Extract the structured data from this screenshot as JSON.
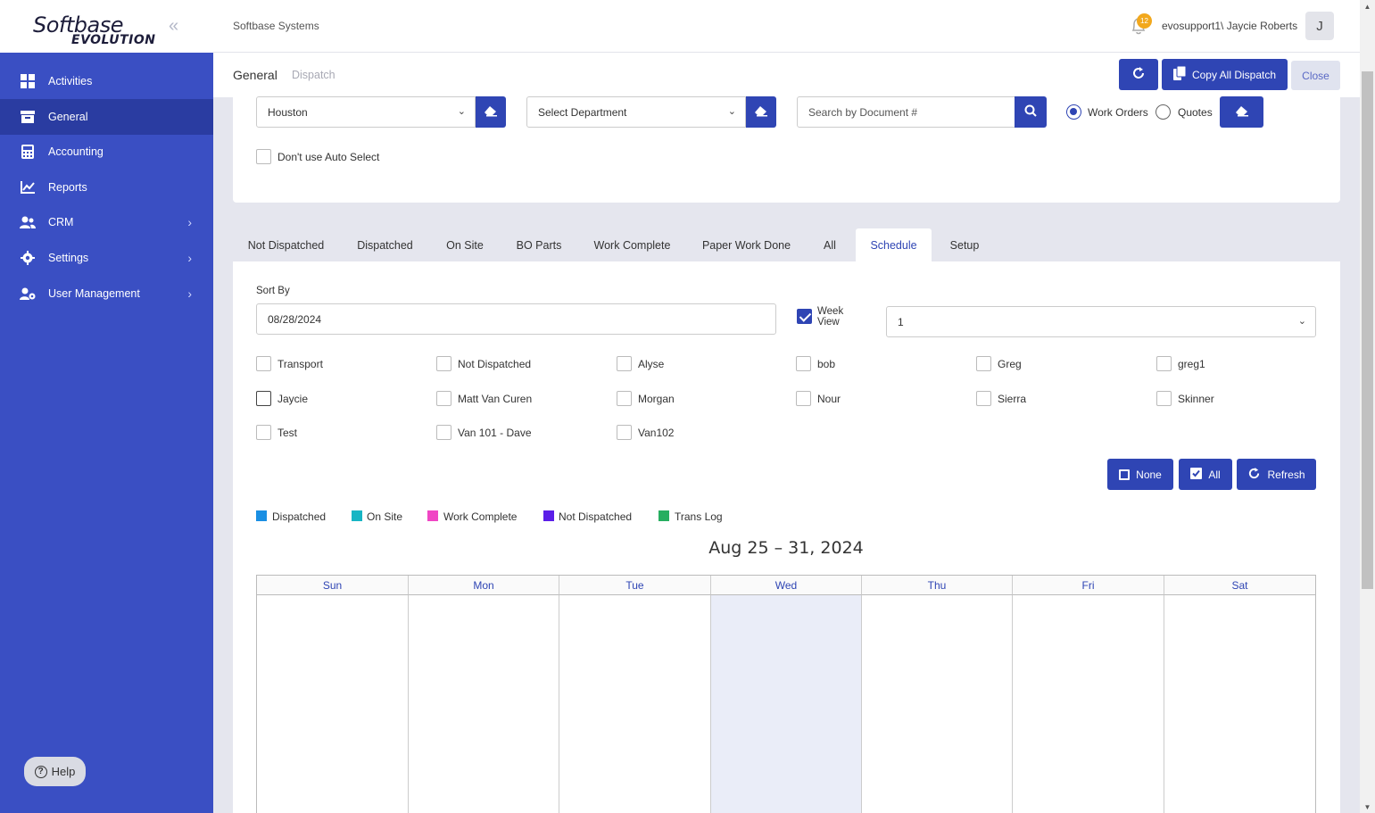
{
  "brand": {
    "logo_main": "Softbase",
    "logo_sub": "EVOLUTION"
  },
  "sidebar": {
    "items": [
      {
        "label": "Activities",
        "icon": "grid-icon"
      },
      {
        "label": "General",
        "icon": "archive-icon",
        "active": true
      },
      {
        "label": "Accounting",
        "icon": "calculator-icon"
      },
      {
        "label": "Reports",
        "icon": "chart-icon"
      },
      {
        "label": "CRM",
        "icon": "users-icon",
        "expandable": true
      },
      {
        "label": "Settings",
        "icon": "gear-icon",
        "expandable": true
      },
      {
        "label": "User Management",
        "icon": "user-gear-icon",
        "expandable": true
      }
    ],
    "help_label": "Help"
  },
  "topbar": {
    "company": "Softbase Systems",
    "notification_count": "12",
    "username": "evosupport1\\ Jaycie Roberts",
    "avatar_initial": "J"
  },
  "subheader": {
    "title": "General",
    "subtitle": "Dispatch",
    "copy_all_label": "Copy All Dispatch",
    "close_label": "Close"
  },
  "filters": {
    "branch_value": "Houston",
    "department_placeholder": "Select Department",
    "search_placeholder": "Search by Document #",
    "radio_work_orders": "Work Orders",
    "radio_quotes": "Quotes",
    "selected_doc_type": "Work Orders",
    "auto_select_label": "Don't use Auto Select"
  },
  "tabs": [
    "Not Dispatched",
    "Dispatched",
    "On Site",
    "BO Parts",
    "Work Complete",
    "Paper Work Done",
    "All",
    "Schedule",
    "Setup"
  ],
  "active_tab": "Schedule",
  "schedule": {
    "sort_by_label": "Sort By",
    "date_value": "08/28/2024",
    "week_view_label_1": "Week",
    "week_view_label_2": "View",
    "week_view_checked": true,
    "count_value": "1",
    "technicians": [
      [
        "Transport",
        "Not Dispatched",
        "Alyse",
        "bob",
        "Greg",
        "greg1"
      ],
      [
        "Jaycie",
        "Matt Van Curen",
        "Morgan",
        "Nour",
        "Sierra",
        "Skinner"
      ],
      [
        "Test",
        "Van 101 - Dave",
        "Van102"
      ]
    ],
    "none_label": "None",
    "all_label": "All",
    "refresh_label": "Refresh",
    "legend": [
      {
        "label": "Dispatched",
        "color": "#1a8fe3"
      },
      {
        "label": "On Site",
        "color": "#17b5c4"
      },
      {
        "label": "Work Complete",
        "color": "#f046c4"
      },
      {
        "label": "Not Dispatched",
        "color": "#5b1ee8"
      },
      {
        "label": "Trans Log",
        "color": "#27ae60"
      }
    ],
    "calendar_title": "Aug 25 – 31, 2024",
    "days": [
      "Sun",
      "Mon",
      "Tue",
      "Wed",
      "Thu",
      "Fri",
      "Sat"
    ],
    "today_column": "Wed"
  },
  "colors": {
    "primary": "#2f45b4",
    "sidebar": "#3a4fc3",
    "sidebar_active": "#2a3ca1"
  }
}
